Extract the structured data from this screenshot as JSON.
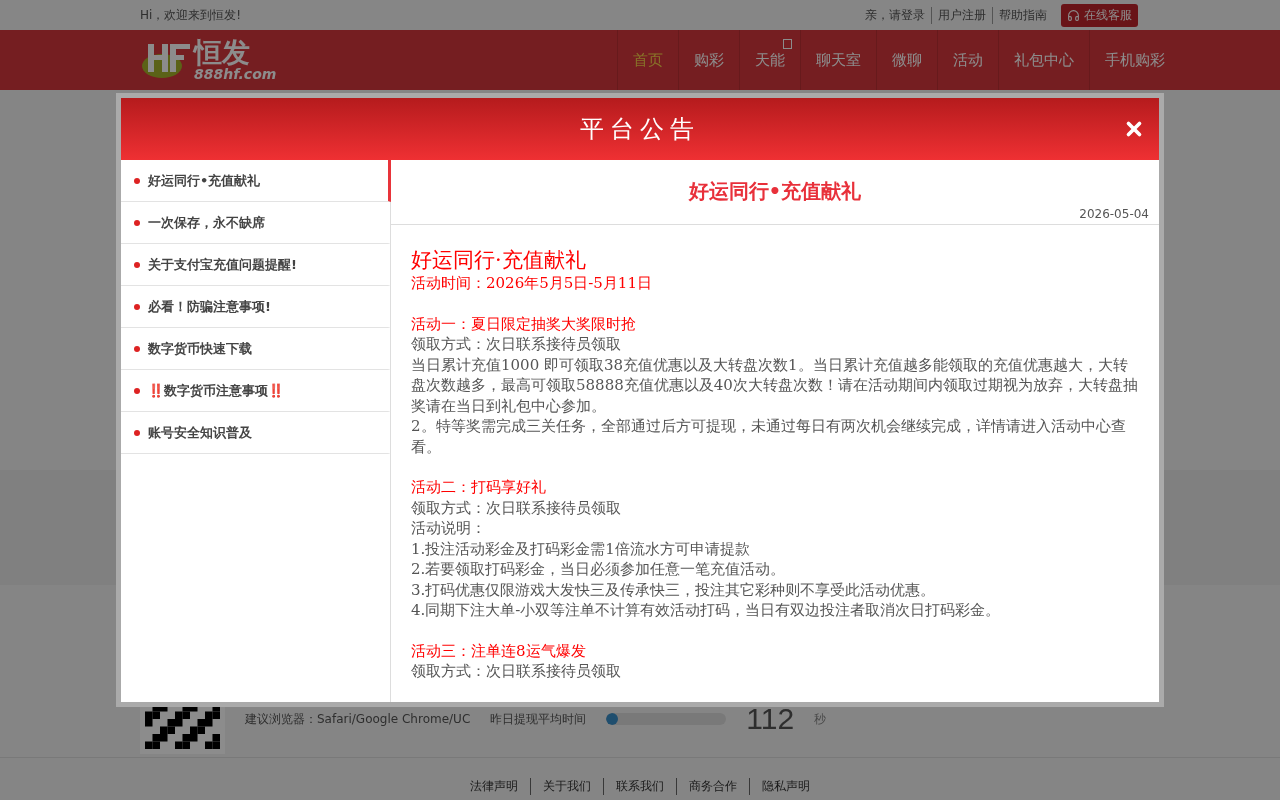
{
  "top_bar": {
    "greeting": "Hi，欢迎来到恒发!",
    "links": [
      "亲，请登录",
      "用户注册",
      "帮助指南"
    ],
    "service_button": "在线客服"
  },
  "header": {
    "logo": {
      "name": "恒发",
      "domain": "888hf.com"
    },
    "nav": [
      {
        "label": "首页",
        "selected": true
      },
      {
        "label": "购彩",
        "selected": false
      },
      {
        "label": "天能",
        "selected": false,
        "badge": true
      },
      {
        "label": "聊天室",
        "selected": false
      },
      {
        "label": "微聊",
        "selected": false
      },
      {
        "label": "活动",
        "selected": false
      },
      {
        "label": "礼包中心",
        "selected": false
      },
      {
        "label": "手机购彩",
        "selected": false
      }
    ]
  },
  "footer": {
    "browser_hint": "建议浏览器：Safari/Google Chrome/UC",
    "withdraw": {
      "label": "昨日提现平均时间",
      "level": 0.1,
      "value": "112",
      "unit": "秒"
    },
    "links": [
      "法律声明",
      "关于我们",
      "联系我们",
      "商务合作",
      "隐私声明"
    ]
  },
  "modal": {
    "title": "平台公告",
    "list": [
      {
        "label": "好运同行•充值献礼",
        "selected": true
      },
      {
        "label": "一次保存，永不缺席",
        "selected": false
      },
      {
        "label": "关于支付宝充值问题提醒!",
        "selected": false
      },
      {
        "label": "必看！防骗注意事项!",
        "selected": false
      },
      {
        "label": "数字货币快速下载",
        "selected": false
      },
      {
        "label": "‼️数字货币注意事项‼️",
        "selected": false
      },
      {
        "label": "账号安全知识普及",
        "selected": false
      }
    ],
    "article": {
      "title": "好运同行•充值献礼",
      "date": "2026-05-04",
      "sections": [
        {
          "lines": [
            {
              "kind": "heading",
              "text": "好运同行·充值献礼"
            },
            {
              "kind": "highlight",
              "text": "活动时间：2026年5月5日-5月11日"
            }
          ]
        },
        {
          "lines": [
            {
              "kind": "highlight",
              "text": "活动一：夏日限定抽奖大奖限时抢"
            },
            {
              "kind": "body",
              "text": "领取方式：次日联系接待员领取"
            },
            {
              "kind": "body",
              "text": "当日累计充值1000 即可领取38充值优惠以及大转盘次数1。当日累计充值越多能领取的充值优惠越大，大转盘次数越多，最高可领取58888充值优惠以及40次大转盘次数！请在活动期间内领取过期视为放弃，大转盘抽奖请在当日到礼包中心参加。"
            },
            {
              "kind": "body",
              "text": "2。特等奖需完成三关任务，全部通过后方可提现，未通过每日有两次机会继续完成，详情请进入活动中心查看。"
            }
          ]
        },
        {
          "lines": [
            {
              "kind": "highlight",
              "text": "活动二：打码享好礼"
            },
            {
              "kind": "body",
              "text": "领取方式：次日联系接待员领取"
            },
            {
              "kind": "body",
              "text": "活动说明："
            },
            {
              "kind": "body",
              "text": "1.投注活动彩金及打码彩金需1倍流水方可申请提款"
            },
            {
              "kind": "body",
              "text": "2.若要领取打码彩金，当日必须参加任意一笔充值活动。"
            },
            {
              "kind": "body",
              "text": "3.打码优惠仅限游戏大发快三及传承快三，投注其它彩种则不享受此活动优惠。"
            },
            {
              "kind": "body",
              "text": "4.同期下注大单-小双等注单不计算有效活动打码，当日有双边投注者取消次日打码彩金。"
            }
          ]
        },
        {
          "lines": [
            {
              "kind": "highlight",
              "text": "活动三：注单连8运气爆发"
            },
            {
              "kind": "body",
              "text": "领取方式：次日联系接待员领取"
            }
          ]
        }
      ]
    }
  }
}
